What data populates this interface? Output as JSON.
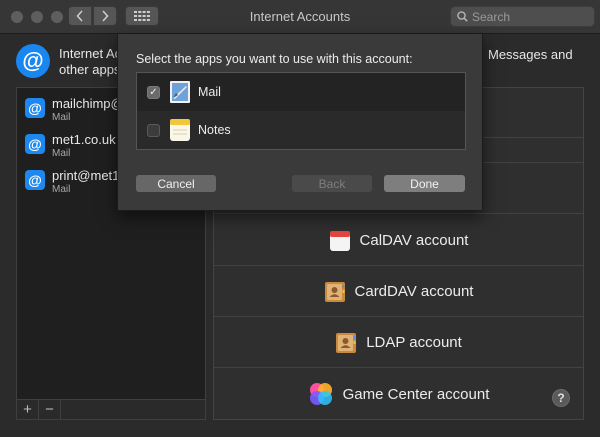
{
  "window": {
    "title": "Internet Accounts",
    "search_placeholder": "Search"
  },
  "header": {
    "description_visible": "Internet Ac",
    "description_line2": "other apps",
    "right_text": "Messages and"
  },
  "accounts": [
    {
      "name": "mailchimp@",
      "type": "Mail"
    },
    {
      "name": "met1.co.uk",
      "type": "Mail"
    },
    {
      "name": "print@met1.",
      "type": "Mail"
    }
  ],
  "list_footer": {
    "add": "+",
    "remove": "−"
  },
  "providers": [
    {
      "label": "",
      "icon": "none"
    },
    {
      "label": "",
      "icon": "none"
    },
    {
      "label": "",
      "icon": "none"
    },
    {
      "label": "CalDAV account",
      "icon": "calendar-icon"
    },
    {
      "label": "CardDAV account",
      "icon": "contacts-icon"
    },
    {
      "label": "LDAP account",
      "icon": "contacts-icon"
    },
    {
      "label": "Game Center account",
      "icon": "game-center-icon"
    }
  ],
  "help": "?",
  "sheet": {
    "prompt": "Select the apps you want to use with this account:",
    "apps": [
      {
        "label": "Mail",
        "checked": true,
        "icon": "mail-stamp-icon"
      },
      {
        "label": "Notes",
        "checked": false,
        "icon": "notes-icon"
      }
    ],
    "buttons": {
      "cancel": "Cancel",
      "back": "Back",
      "done": "Done"
    }
  }
}
